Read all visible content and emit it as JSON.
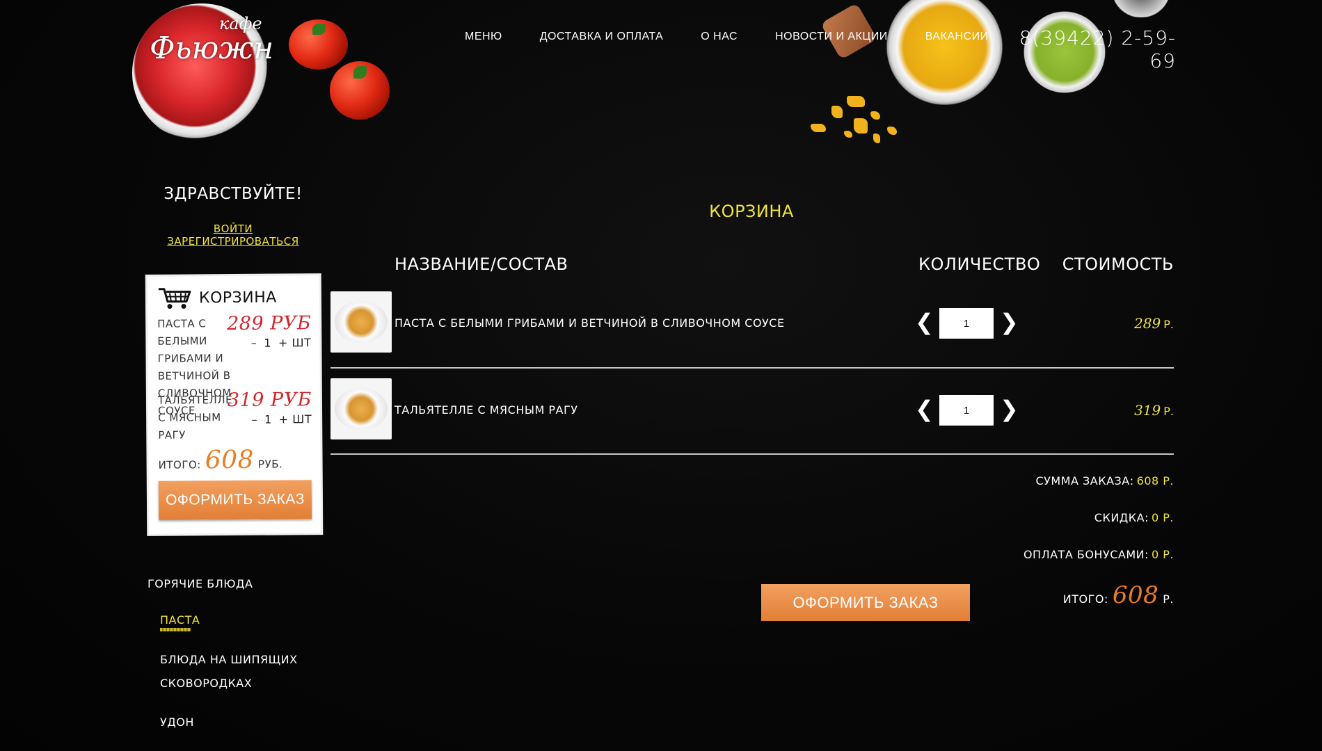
{
  "header": {
    "logo_top": "кафе",
    "logo_main": "Фьюжн",
    "nav": [
      "МЕНЮ",
      "ДОСТАВКА И ОПЛАТА",
      "О НАС",
      "НОВОСТИ И АКЦИИ",
      "ВАКАНСИИ"
    ],
    "phone": "8(39422) 2-59-69"
  },
  "sidebar": {
    "greeting": "ЗДРАВСТВУЙТЕ!",
    "login": "ВОЙТИ",
    "register": "ЗАРЕГИСТРИРОВАТЬСЯ",
    "mini_cart": {
      "title": "КОРЗИНА",
      "items": [
        {
          "name": "ПАСТА С БЕЛЫМИ ГРИБАМИ И ВЕТЧИНОЙ В СЛИВОЧНОМ СОУСЕ",
          "price": "289 РУБ",
          "minus": "–",
          "qty": "1",
          "plus": "+ ШТ"
        },
        {
          "name": "ТАЛЬЯТЕЛЛЕ С МЯСНЫМ РАГУ",
          "price": "319 РУБ",
          "minus": "–",
          "qty": "1",
          "plus": "+ ШТ"
        }
      ],
      "total_label": "ИТОГО:",
      "total_value": "608",
      "total_currency": "РУБ.",
      "order_button": "ОФОРМИТЬ ЗАКАЗ"
    },
    "categories": {
      "main": "ГОРЯЧИЕ БЛЮДА",
      "items": [
        "ПАСТА",
        "БЛЮДА НА ШИПЯЩИХ СКОВОРОДКАХ",
        "УДОН"
      ],
      "active_index": 0
    }
  },
  "cart": {
    "title": "КОРЗИНА",
    "columns": {
      "name": "НАЗВАНИЕ/СОСТАВ",
      "quantity": "КОЛИЧЕСТВО",
      "cost": "СТОИМОСТЬ"
    },
    "rows": [
      {
        "name": "ПАСТА С БЕЛЫМИ ГРИБАМИ И ВЕТЧИНОЙ В СЛИВОЧНОМ СОУСЕ",
        "qty": "1",
        "price": "289",
        "currency": "Р."
      },
      {
        "name": "ТАЛЬЯТЕЛЛЕ С МЯСНЫМ РАГУ",
        "qty": "1",
        "price": "319",
        "currency": "Р."
      }
    ],
    "summary": {
      "order_sum_label": "СУММА ЗАКАЗА:",
      "order_sum_value": "608 Р.",
      "discount_label": "СКИДКА:",
      "discount_value": "0 Р.",
      "bonus_label": "ОПЛАТА БОНУСАМИ:",
      "bonus_value": "0 Р.",
      "total_label": "ИТОГО:",
      "total_value": "608",
      "total_currency": "Р."
    },
    "order_button": "ОФОРМИТЬ ЗАКАЗ"
  },
  "colors": {
    "background": "#070707",
    "accent_yellow": "#f1e43f",
    "accent_orange": "#ea7d24",
    "price_red": "#d1262d"
  },
  "icons": [
    "cart-icon",
    "chevron-left-icon",
    "chevron-right-icon"
  ]
}
